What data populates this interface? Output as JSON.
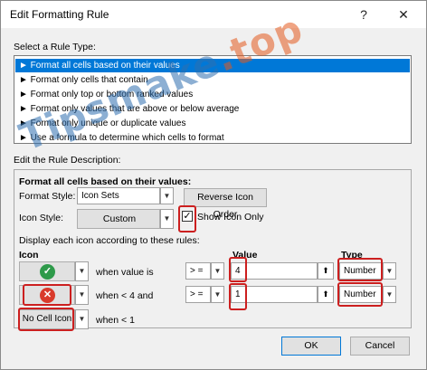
{
  "window": {
    "title": "Edit Formatting Rule",
    "help_glyph": "?",
    "close_glyph": "✕"
  },
  "rule_type": {
    "label": "Select a Rule Type:",
    "items": [
      "► Format all cells based on their values",
      "► Format only cells that contain",
      "► Format only top or bottom ranked values",
      "► Format only values that are above or below average",
      "► Format only unique or duplicate values",
      "► Use a formula to determine which cells to format"
    ],
    "selected_index": 0
  },
  "description": {
    "label": "Edit the Rule Description:",
    "heading": "Format all cells based on their values:",
    "format_style_label": "Format Style:",
    "format_style_value": "Icon Sets",
    "reverse_button": "Reverse Icon Order",
    "icon_style_label": "Icon Style:",
    "icon_style_value": "Custom",
    "show_icon_only_label": "Show Icon Only",
    "show_icon_only_checked": true,
    "rules_caption": "Display each icon according to these rules:",
    "col_icon": "Icon",
    "col_value": "Value",
    "col_type": "Type",
    "rows": [
      {
        "icon": "green-check-icon",
        "condition": "when value is",
        "operator": "> =",
        "value": "4",
        "type": "Number"
      },
      {
        "icon": "red-x-icon",
        "condition": "when < 4 and",
        "operator": "> =",
        "value": "1",
        "type": "Number"
      },
      {
        "icon_text": "No Cell Icon",
        "condition": "when < 1"
      }
    ]
  },
  "footer": {
    "ok": "OK",
    "cancel": "Cancel"
  },
  "watermark": {
    "text": "Tipsmake",
    "dot_suffix": ".top"
  },
  "colors": {
    "selection": "#0078d7",
    "highlight_red": "#cc1f1f",
    "green": "#2e9a4a",
    "red": "#d93a2b"
  }
}
